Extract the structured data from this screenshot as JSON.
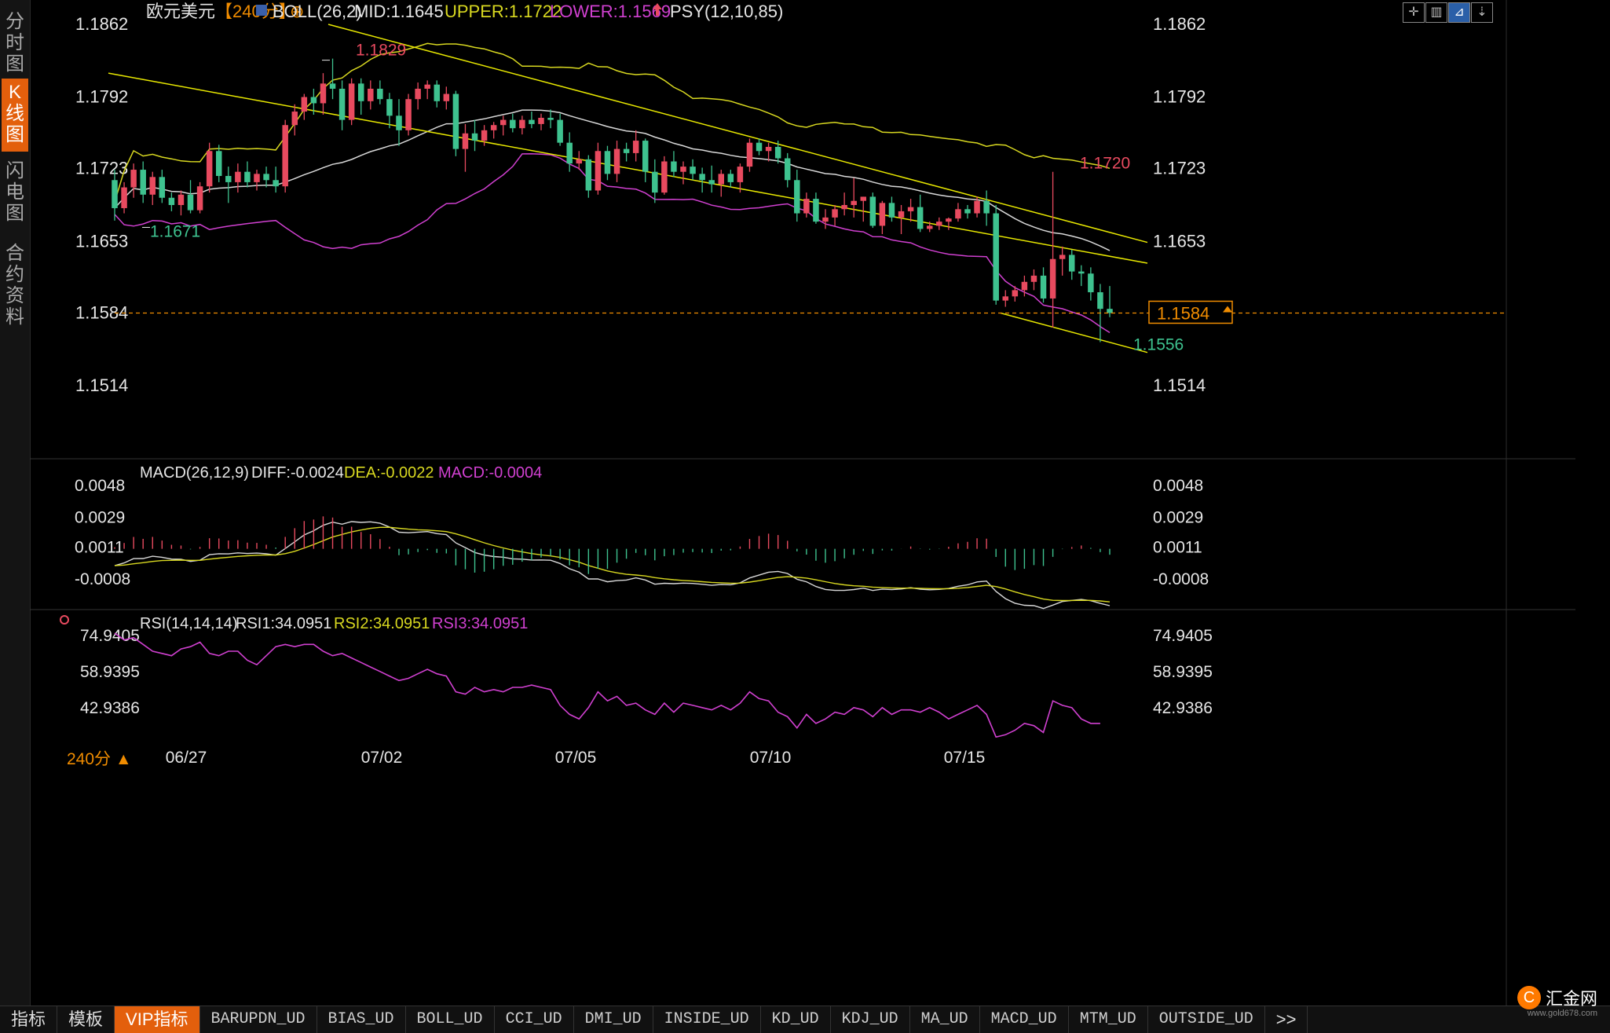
{
  "sidebar": {
    "tabs": [
      {
        "label": "分时图",
        "active": false
      },
      {
        "label": "K线图",
        "active": true
      },
      {
        "label": "闪电图",
        "active": false
      },
      {
        "label": "合约资料",
        "active": false
      }
    ]
  },
  "toolbar_icons": [
    "crosshair-icon",
    "candle-icon",
    "line-chart-icon",
    "arrow-down-icon"
  ],
  "header": {
    "symbol": "欧元美元",
    "period": "【240分】",
    "add_symbol": "⊕",
    "boll_label": "BOLL(26,2)",
    "mid": "MID:1.1645",
    "upper": "UPPER:1.1722",
    "lower": "LOWER:1.1569",
    "psy": "PSY(12,10,85)"
  },
  "main_axis": {
    "ticks": [
      "1.1862",
      "1.1792",
      "1.1723",
      "1.1653",
      "1.1584",
      "1.1514"
    ],
    "current_price": "1.1584",
    "high_label": "1.1829",
    "low_label": "1.1671",
    "high2_label": "1.1720",
    "low2_label": "1.1556"
  },
  "macd": {
    "label": "MACD(26,12,9)",
    "diff": "DIFF:-0.0024",
    "dea": "DEA:-0.0022",
    "macd": "MACD:-0.0004",
    "ticks": [
      "0.0048",
      "0.0029",
      "0.0011",
      "-0.0008"
    ]
  },
  "rsi": {
    "label": "RSI(14,14,14)",
    "rsi1": "RSI1:34.0951",
    "rsi2": "RSI2:34.0951",
    "rsi3": "RSI3:34.0951",
    "ticks": [
      "74.9405",
      "58.9395",
      "42.9386"
    ]
  },
  "x_axis": {
    "dates": [
      "06/27",
      "07/02",
      "07/05",
      "07/10",
      "07/15"
    ],
    "period_button": "240分 ▲"
  },
  "bottom_tabs": [
    {
      "label": "指标",
      "style": "normal"
    },
    {
      "label": "模板",
      "style": "normal"
    },
    {
      "label": "VIP指标",
      "style": "vip"
    },
    {
      "label": "BARUPDN_UD",
      "style": "mono"
    },
    {
      "label": "BIAS_UD",
      "style": "mono"
    },
    {
      "label": "BOLL_UD",
      "style": "mono"
    },
    {
      "label": "CCI_UD",
      "style": "mono"
    },
    {
      "label": "DMI_UD",
      "style": "mono"
    },
    {
      "label": "INSIDE_UD",
      "style": "mono"
    },
    {
      "label": "KD_UD",
      "style": "mono"
    },
    {
      "label": "KDJ_UD",
      "style": "mono"
    },
    {
      "label": "MA_UD",
      "style": "mono"
    },
    {
      "label": "MACD_UD",
      "style": "mono"
    },
    {
      "label": "MTM_UD",
      "style": "mono"
    },
    {
      "label": "OUTSIDE_UD",
      "style": "mono"
    },
    {
      "label": ">>",
      "style": "normal"
    }
  ],
  "logo": {
    "name": "汇金网",
    "url": "www.gold678.com"
  },
  "colors": {
    "up": "#e84a5f",
    "down": "#3ec28f",
    "yellow": "#d8d820",
    "magenta": "#d040d0",
    "white_line": "#d8d8d8",
    "price_box": "#f08c00",
    "channel": "#e8e800"
  },
  "chart_data": {
    "type": "candlestick",
    "timeframe": "240分",
    "dates": [
      "06/27",
      "07/02",
      "07/05",
      "07/10",
      "07/15"
    ],
    "price_ylim": [
      1.1514,
      1.1862
    ],
    "boll": {
      "mid": 1.1645,
      "upper": 1.1722,
      "lower": 1.1569
    },
    "current_price": 1.1584,
    "marked_high": 1.1829,
    "marked_low": 1.1671,
    "recent_high": 1.172,
    "recent_low": 1.1556,
    "candles_ohlc": [
      [
        1.1712,
        1.1722,
        1.1673,
        1.1685
      ],
      [
        1.1685,
        1.171,
        1.168,
        1.1705
      ],
      [
        1.1705,
        1.1728,
        1.1695,
        1.1722
      ],
      [
        1.1722,
        1.173,
        1.169,
        1.1698
      ],
      [
        1.1698,
        1.172,
        1.1688,
        1.1715
      ],
      [
        1.1715,
        1.1722,
        1.169,
        1.1695
      ],
      [
        1.1695,
        1.17,
        1.1682,
        1.1688
      ],
      [
        1.1688,
        1.1702,
        1.1678,
        1.1698
      ],
      [
        1.1698,
        1.1712,
        1.168,
        1.1683
      ],
      [
        1.1683,
        1.171,
        1.168,
        1.1706
      ],
      [
        1.1706,
        1.1748,
        1.17,
        1.174
      ],
      [
        1.174,
        1.1746,
        1.171,
        1.1716
      ],
      [
        1.1716,
        1.1725,
        1.169,
        1.171
      ],
      [
        1.171,
        1.1728,
        1.17,
        1.172
      ],
      [
        1.172,
        1.173,
        1.1705,
        1.171
      ],
      [
        1.171,
        1.1722,
        1.1702,
        1.1718
      ],
      [
        1.1718,
        1.1725,
        1.1705,
        1.1712
      ],
      [
        1.1712,
        1.1725,
        1.17,
        1.1706
      ],
      [
        1.1706,
        1.177,
        1.17,
        1.1765
      ],
      [
        1.1765,
        1.1785,
        1.1755,
        1.1778
      ],
      [
        1.1778,
        1.1795,
        1.177,
        1.1792
      ],
      [
        1.1792,
        1.18,
        1.1775,
        1.1786
      ],
      [
        1.1786,
        1.1815,
        1.1775,
        1.1805
      ],
      [
        1.1805,
        1.1829,
        1.179,
        1.18
      ],
      [
        1.18,
        1.1808,
        1.176,
        1.177
      ],
      [
        1.177,
        1.181,
        1.1765,
        1.1805
      ],
      [
        1.1805,
        1.181,
        1.1775,
        1.1788
      ],
      [
        1.1788,
        1.1808,
        1.178,
        1.18
      ],
      [
        1.18,
        1.1808,
        1.1785,
        1.179
      ],
      [
        1.179,
        1.1796,
        1.1762,
        1.1774
      ],
      [
        1.1774,
        1.179,
        1.1745,
        1.176
      ],
      [
        1.176,
        1.1795,
        1.1755,
        1.179
      ],
      [
        1.179,
        1.1806,
        1.178,
        1.18
      ],
      [
        1.18,
        1.1808,
        1.179,
        1.1804
      ],
      [
        1.1804,
        1.1808,
        1.1782,
        1.1788
      ],
      [
        1.1788,
        1.1802,
        1.178,
        1.1795
      ],
      [
        1.1795,
        1.1798,
        1.1735,
        1.1742
      ],
      [
        1.1742,
        1.1766,
        1.172,
        1.1757
      ],
      [
        1.1757,
        1.177,
        1.174,
        1.175
      ],
      [
        1.175,
        1.1765,
        1.1745,
        1.176
      ],
      [
        1.176,
        1.1768,
        1.1752,
        1.1765
      ],
      [
        1.1765,
        1.1774,
        1.1755,
        1.177
      ],
      [
        1.177,
        1.1776,
        1.1758,
        1.1762
      ],
      [
        1.1762,
        1.1774,
        1.1756,
        1.177
      ],
      [
        1.177,
        1.1778,
        1.1762,
        1.1766
      ],
      [
        1.1766,
        1.1776,
        1.176,
        1.1772
      ],
      [
        1.1772,
        1.178,
        1.1762,
        1.177
      ],
      [
        1.177,
        1.1776,
        1.1745,
        1.1748
      ],
      [
        1.1748,
        1.1758,
        1.172,
        1.1728
      ],
      [
        1.1728,
        1.174,
        1.1722,
        1.1732
      ],
      [
        1.1732,
        1.1736,
        1.1695,
        1.1702
      ],
      [
        1.1702,
        1.1748,
        1.1698,
        1.174
      ],
      [
        1.174,
        1.1745,
        1.1712,
        1.1718
      ],
      [
        1.1718,
        1.175,
        1.171,
        1.1742
      ],
      [
        1.1742,
        1.1748,
        1.173,
        1.1738
      ],
      [
        1.1738,
        1.176,
        1.173,
        1.175
      ],
      [
        1.175,
        1.1752,
        1.171,
        1.172
      ],
      [
        1.172,
        1.1732,
        1.169,
        1.17
      ],
      [
        1.17,
        1.1735,
        1.1698,
        1.173
      ],
      [
        1.173,
        1.174,
        1.1715,
        1.172
      ],
      [
        1.172,
        1.173,
        1.1708,
        1.1725
      ],
      [
        1.1725,
        1.1732,
        1.1712,
        1.1718
      ],
      [
        1.1718,
        1.1724,
        1.17,
        1.1712
      ],
      [
        1.1712,
        1.1726,
        1.17,
        1.1708
      ],
      [
        1.1708,
        1.1722,
        1.1696,
        1.1718
      ],
      [
        1.1718,
        1.1722,
        1.1705,
        1.171
      ],
      [
        1.171,
        1.1728,
        1.17,
        1.1725
      ],
      [
        1.1725,
        1.1752,
        1.172,
        1.1748
      ],
      [
        1.1748,
        1.1752,
        1.1736,
        1.174
      ],
      [
        1.174,
        1.1748,
        1.173,
        1.1744
      ],
      [
        1.1744,
        1.175,
        1.1728,
        1.1733
      ],
      [
        1.1733,
        1.1738,
        1.1705,
        1.1712
      ],
      [
        1.1712,
        1.1722,
        1.1672,
        1.168
      ],
      [
        1.168,
        1.17,
        1.1676,
        1.1694
      ],
      [
        1.1694,
        1.17,
        1.167,
        1.1672
      ],
      [
        1.1672,
        1.1684,
        1.1665,
        1.1676
      ],
      [
        1.1676,
        1.1688,
        1.1668,
        1.1684
      ],
      [
        1.1684,
        1.17,
        1.1678,
        1.1688
      ],
      [
        1.1688,
        1.1714,
        1.1676,
        1.1692
      ],
      [
        1.1692,
        1.1696,
        1.1672,
        1.1696
      ],
      [
        1.1696,
        1.17,
        1.1666,
        1.1668
      ],
      [
        1.1668,
        1.1692,
        1.166,
        1.169
      ],
      [
        1.169,
        1.1696,
        1.1672,
        1.1676
      ],
      [
        1.1676,
        1.1688,
        1.166,
        1.1682
      ],
      [
        1.1682,
        1.1694,
        1.1672,
        1.1686
      ],
      [
        1.1686,
        1.1698,
        1.1662,
        1.1665
      ],
      [
        1.1665,
        1.1672,
        1.1662,
        1.1668
      ],
      [
        1.1668,
        1.1676,
        1.1664,
        1.1672
      ],
      [
        1.1672,
        1.1676,
        1.1664,
        1.1675
      ],
      [
        1.1675,
        1.169,
        1.1672,
        1.1684
      ],
      [
        1.1684,
        1.1688,
        1.1675,
        1.168
      ],
      [
        1.168,
        1.1696,
        1.1676,
        1.1692
      ],
      [
        1.1692,
        1.1702,
        1.1668,
        1.168
      ],
      [
        1.168,
        1.1688,
        1.1592,
        1.1596
      ],
      [
        1.1596,
        1.1606,
        1.159,
        1.16
      ],
      [
        1.16,
        1.161,
        1.1595,
        1.1606
      ],
      [
        1.1606,
        1.162,
        1.16,
        1.1614
      ],
      [
        1.1614,
        1.1626,
        1.1606,
        1.162
      ],
      [
        1.162,
        1.1628,
        1.1594,
        1.1598
      ],
      [
        1.1598,
        1.172,
        1.157,
        1.1636
      ],
      [
        1.1636,
        1.1648,
        1.162,
        1.164
      ],
      [
        1.164,
        1.1645,
        1.1616,
        1.1624
      ],
      [
        1.1624,
        1.163,
        1.161,
        1.1622
      ],
      [
        1.1622,
        1.1628,
        1.1596,
        1.1604
      ],
      [
        1.1604,
        1.1612,
        1.1556,
        1.1588
      ],
      [
        1.1588,
        1.161,
        1.158,
        1.1584
      ]
    ],
    "macd_ylim": [
      -0.0028,
      0.0048
    ],
    "macd_values": {
      "diff": -0.0024,
      "dea": -0.0022,
      "macd": -0.0004
    },
    "rsi_ylim": [
      26.9,
      80.0
    ],
    "rsi_values": {
      "rsi1": 34.0951,
      "rsi2": 34.0951,
      "rsi3": 34.0951
    },
    "rsi_series": [
      76,
      73,
      74,
      71,
      68,
      67,
      66,
      69,
      70,
      72,
      67,
      66,
      68,
      68,
      64,
      62,
      66,
      70,
      71,
      70,
      71,
      71,
      68,
      66,
      67,
      65,
      63,
      61,
      59,
      57,
      55,
      56,
      58,
      60,
      58,
      57,
      50,
      49,
      52,
      50,
      51,
      50,
      52,
      52,
      53,
      52,
      51,
      44,
      40,
      38,
      43,
      50,
      46,
      48,
      44,
      45,
      42,
      40,
      45,
      41,
      45,
      44,
      43,
      42,
      44,
      42,
      45,
      50,
      47,
      46,
      41,
      39,
      34,
      40,
      36,
      38,
      41,
      40,
      43,
      42,
      39,
      43,
      40,
      42,
      42,
      41,
      43,
      41,
      38,
      40,
      42,
      44,
      40,
      30,
      31,
      33,
      36,
      35,
      32,
      46,
      44,
      43,
      38,
      36,
      36
    ]
  }
}
